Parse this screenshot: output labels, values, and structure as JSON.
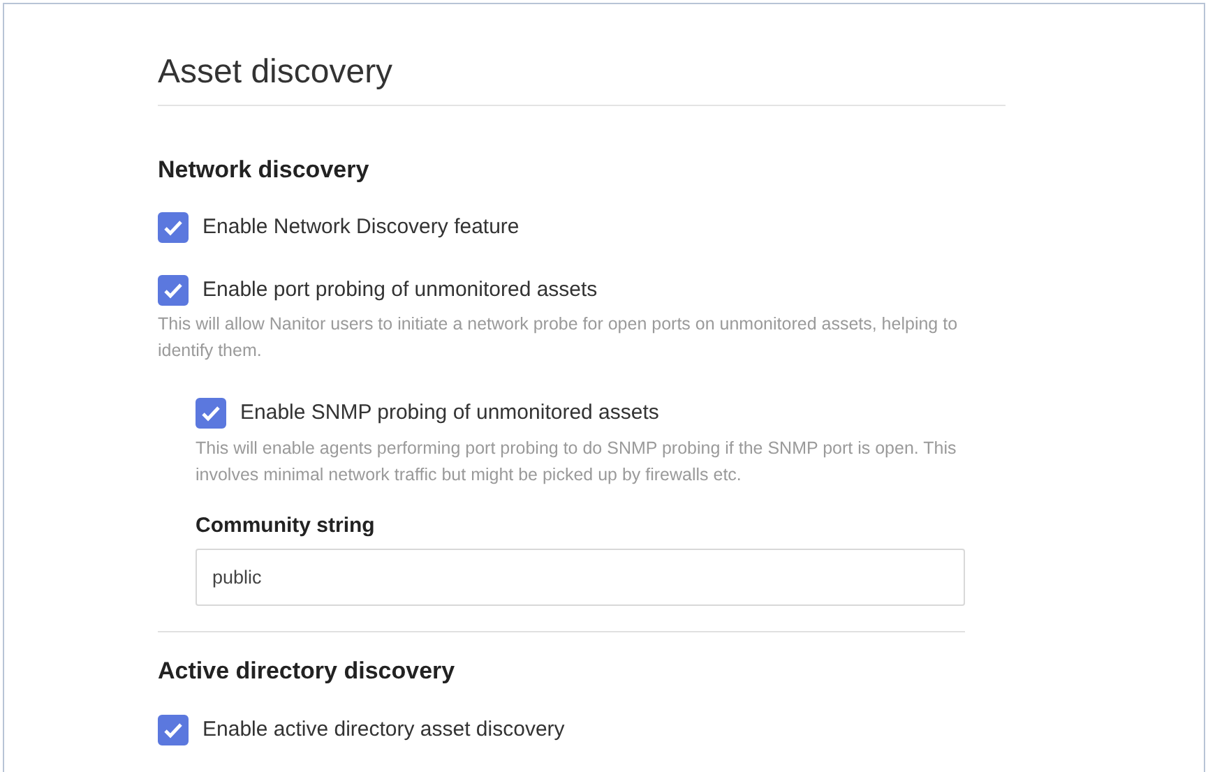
{
  "title": "Asset discovery",
  "sections": [
    {
      "heading": "Network discovery",
      "items": [
        {
          "kind": "checkbox",
          "label": "Enable Network Discovery feature",
          "checked": true
        },
        {
          "kind": "checkbox",
          "label": "Enable port probing of unmonitored assets",
          "checked": true,
          "help": "This will allow Nanitor users to initiate a network probe for open ports on unmonitored assets, helping to identify them.",
          "children": [
            {
              "kind": "checkbox",
              "label": "Enable SNMP probing of unmonitored assets",
              "checked": true,
              "help": "This will enable agents performing port probing to do SNMP probing if the SNMP port is open. This involves minimal network traffic but might be picked up by firewalls etc."
            },
            {
              "kind": "field",
              "label": "Community string",
              "value": "public"
            }
          ]
        }
      ]
    },
    {
      "heading": "Active directory discovery",
      "items": [
        {
          "kind": "checkbox",
          "label": "Enable active directory asset discovery",
          "checked": true
        }
      ]
    }
  ]
}
